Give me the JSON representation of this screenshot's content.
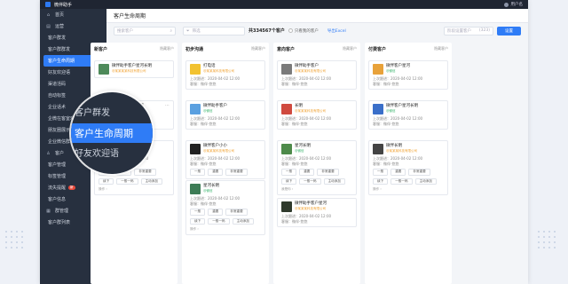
{
  "app": {
    "title": "微伴助手",
    "user": "用户名"
  },
  "sidebar": {
    "items": [
      {
        "label": "首页",
        "icon": "home-icon",
        "glyph": "⌂",
        "main": true
      },
      {
        "label": "运营",
        "icon": "calendar-icon",
        "glyph": "▤",
        "main": true
      },
      {
        "label": "客户群发"
      },
      {
        "label": "客户群群发"
      },
      {
        "label": "客户生命周期",
        "active": true
      },
      {
        "label": "好友欢迎语"
      },
      {
        "label": "渠道活码"
      },
      {
        "label": "自动标签"
      },
      {
        "label": "企业话术"
      },
      {
        "label": "企微在客室欢迎语"
      },
      {
        "label": "朋友圈展示"
      },
      {
        "label": "企业微信群"
      },
      {
        "label": "客户",
        "icon": "user-icon",
        "glyph": "♙",
        "main": true
      },
      {
        "label": "客户管理"
      },
      {
        "label": "标签管理"
      },
      {
        "label": "流失提醒",
        "badge": "新"
      },
      {
        "label": "客户信息"
      },
      {
        "label": "群管理",
        "icon": "group-icon",
        "glyph": "▦",
        "main": true
      },
      {
        "label": "客户群列表"
      }
    ]
  },
  "page": {
    "title": "客户生命周期"
  },
  "toolbar": {
    "search_placeholder": "搜索客户",
    "filter_label": "筛选",
    "count_text": "共334567个客户",
    "only_mine": "只看我的客户",
    "export": "导出Excel",
    "settings_placeholder": "阶段设置客户",
    "settings_count": "(323)",
    "settings_button": "设置"
  },
  "zoom": {
    "above": "客户群发",
    "active": "客户生命周期",
    "below": "好友欢迎语"
  },
  "columns": [
    {
      "title": "新客户",
      "more": "隐藏客户",
      "cards": [
        {
          "name": "微伴助手客户星河长明",
          "org": "@某某某某科技有限公司",
          "org_color": "orange",
          "avatar": "#4e8a5a",
          "meta": [],
          "tags": [],
          "op": ""
        },
        {
          "name": "微伴助手客户巍峨",
          "org": "@某某某科技有限公司",
          "org_color": "orange",
          "avatar": "#b2473a",
          "meta": [
            "添加：2020-04-02 12:00",
            "客服：微伴-悠悠"
          ],
          "tags": [],
          "op": ""
        },
        {
          "name": "星河长明",
          "org": "@微信",
          "org_color": "green",
          "avatar": "#c96a8e",
          "meta": [
            "上次跟进：2020-04-02 12:00",
            "客服：微伴-悠悠"
          ],
          "tags": [
            "一般",
            "重要",
            "非常重要"
          ],
          "tags2": [
            "续下",
            "一般一码",
            "主动添加"
          ],
          "op": "操作 ›"
        }
      ]
    },
    {
      "title": "初步沟通",
      "more": "隐藏客户",
      "cards": [
        {
          "name": "打电话",
          "org": "@某某某科技有限公司",
          "org_color": "orange",
          "avatar": "#f2c230",
          "meta": [
            "上次跟进：2020-04-02 12:00",
            "客服：微伴-悠悠"
          ],
          "tags": [],
          "op": ""
        },
        {
          "name": "微伴助手客户",
          "org": "@微信",
          "org_color": "green",
          "avatar": "#5aa0e0",
          "meta": [
            "上次跟进：2020-04-02 12:00",
            "客服：微伴-悠悠"
          ],
          "tags": [],
          "op": ""
        },
        {
          "name": "微伴客户小小",
          "org": "@某某某科技有限公司",
          "org_color": "orange",
          "avatar": "#222222",
          "meta": [
            "上次跟进：2020-04-02 12:00",
            "客服：微伴-悠悠"
          ],
          "tags": [
            "一般",
            "重要",
            "非常重要"
          ],
          "tags2": [],
          "op": ""
        },
        {
          "name": "星河长明",
          "org": "@微信",
          "org_color": "green",
          "avatar": "#3d7c56",
          "meta": [
            "上次跟进：2020-04-02 12:00",
            "客服：微伴-悠悠"
          ],
          "tags": [
            "一般",
            "重要",
            "非常重要"
          ],
          "tags2": [
            "续下",
            "一般一码",
            "主动添加"
          ],
          "op": "操作 ›"
        }
      ]
    },
    {
      "title": "意向客户",
      "more": "隐藏客户",
      "cards": [
        {
          "name": "微伴助手客户",
          "org": "@某某某科技有限公司",
          "org_color": "orange",
          "avatar": "#7a7a7a",
          "meta": [
            "上次跟进：2020-04-02 12:00",
            "客服：微伴-悠悠"
          ],
          "tags": [],
          "op": ""
        },
        {
          "name": "长明",
          "org": "@某某某科技有限公司",
          "org_color": "orange",
          "avatar": "#d04a3f",
          "meta": [
            "上次跟进：2020-04-02 12:00",
            "客服：微伴-悠悠"
          ],
          "tags": [],
          "op": ""
        },
        {
          "name": "星河长明",
          "org": "@微信",
          "org_color": "green",
          "avatar": "#4d8a4a",
          "meta": [
            "上次跟进：2020-04-02 12:00",
            "客服：微伴-悠悠"
          ],
          "tags": [
            "一般",
            "重要",
            "非常重要"
          ],
          "tags2": [
            "续下",
            "一般一码",
            "主动添加"
          ],
          "op": "我是你 ›"
        },
        {
          "name": "微伴助手客户星河",
          "org": "@某某某科技有限公司",
          "org_color": "orange",
          "avatar": "#2f3a2c",
          "meta": [
            "上次跟进：2020-04-02 12:00",
            "客服：微伴-悠悠"
          ],
          "tags": [],
          "op": ""
        }
      ]
    },
    {
      "title": "付费客户",
      "more": "隐藏客户",
      "cards": [
        {
          "name": "微伴客户星河",
          "org": "@微信",
          "org_color": "green",
          "avatar": "#e8a23a",
          "meta": [
            "上次跟进：2020-04-02 12:00",
            "客服：微伴-悠悠"
          ],
          "tags": [],
          "op": ""
        },
        {
          "name": "微伴客户星河长明",
          "org": "@微信",
          "org_color": "green",
          "avatar": "#3a6fc9",
          "meta": [
            "上次跟进：2020-04-02 12:00",
            "客服：微伴-悠悠"
          ],
          "tags": [],
          "op": ""
        },
        {
          "name": "微伴长明",
          "org": "@某某某科技有限公司",
          "org_color": "orange",
          "avatar": "#444444",
          "meta": [
            "上次跟进：2020-04-02 12:00",
            "客服：微伴-悠悠"
          ],
          "tags": [
            "一般",
            "重要",
            "非常重要"
          ],
          "tags2": [
            "续下",
            "一般一码",
            "主动添加"
          ],
          "op": "操作 ›"
        }
      ]
    }
  ]
}
